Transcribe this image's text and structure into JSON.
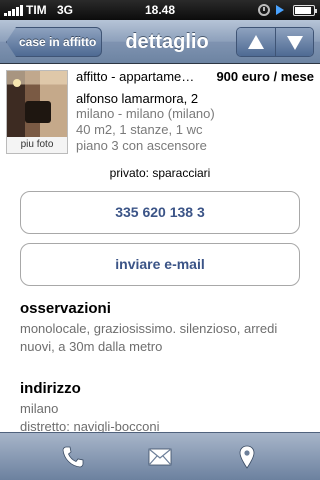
{
  "status_bar": {
    "carrier": "TIM",
    "network": "3G",
    "time": "18.48",
    "battery_level": 0.9
  },
  "nav": {
    "back_label": "case in affitto",
    "title": "dettaglio",
    "prev_icon": "arrow-up-icon",
    "next_icon": "arrow-down-icon"
  },
  "listing": {
    "photo_caption": "piu foto",
    "type": "affitto - appartamento",
    "price": "900 euro / mese",
    "street": "alfonso lamarmora, 2",
    "city": "milano - milano (milano)",
    "size": "40 m2, 1 stanze, 1 wc",
    "floor": "piano 3 con ascensore",
    "seller": "privato: sparacciari"
  },
  "actions": {
    "phone": "335 620 138 3",
    "email": "inviare e-mail"
  },
  "observations": {
    "title": "osservazioni",
    "text": "monolocale, graziosissimo. silenzioso, arredi nuovi, a 30m dalla metro"
  },
  "address": {
    "title": "indirizzo",
    "line1": "milano",
    "line2": "distretto: navigli-bocconi"
  },
  "tab_bar": {
    "items": [
      "phone-icon",
      "mail-icon",
      "map-pin-icon"
    ]
  }
}
